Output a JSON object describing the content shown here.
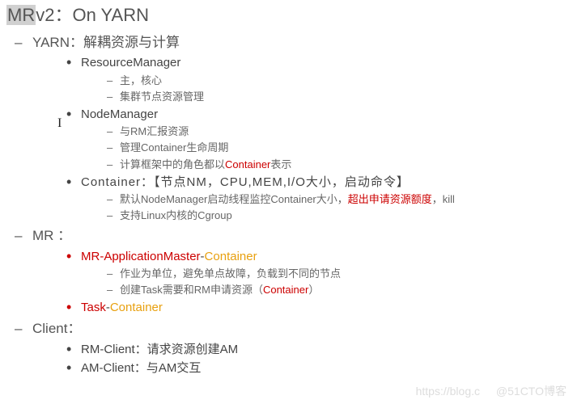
{
  "title": {
    "hl": "MR",
    "rest": "v2：On YARN"
  },
  "sections": {
    "yarn": {
      "heading": "YARN：解耦资源与计算",
      "rm": {
        "label": "ResourceManager",
        "sub1": "主，核心",
        "sub2": "集群节点资源管理"
      },
      "nm": {
        "label": "NodeManager",
        "sub1": "与RM汇报资源",
        "sub2": "管理Container生命周期",
        "sub3_prefix": "计算框架中的角色都以",
        "sub3_mid": "Container",
        "sub3_suffix": "表示"
      },
      "container": {
        "label": "Container：【节点NM，CPU,MEM,I/O大小，启动命令】",
        "sub1_prefix": "默认NodeManager启动线程监控Container大小，",
        "sub1_red": "超出申请资源额度",
        "sub1_suffix": "，kill",
        "sub2": "支持Linux内核的Cgroup"
      }
    },
    "mr": {
      "heading": "MR ：",
      "appmaster": {
        "red1": "MR-ApplicationMaster",
        "dash": "-",
        "orange": "Container",
        "sub1": "作业为单位，避免单点故障，负载到不同的节点",
        "sub2_prefix": "创建Task需要和RM申请资源（",
        "sub2_red": "Container",
        "sub2_suffix": "）"
      },
      "task": {
        "red": "Task",
        "dash": "-",
        "orange": "Container"
      }
    },
    "client": {
      "heading": "Client：",
      "rmclient": "RM-Client：请求资源创建AM",
      "amclient": "AM-Client：与AM交互"
    }
  },
  "watermark1": "https://blog.c",
  "watermark2": "@51CTO博客"
}
